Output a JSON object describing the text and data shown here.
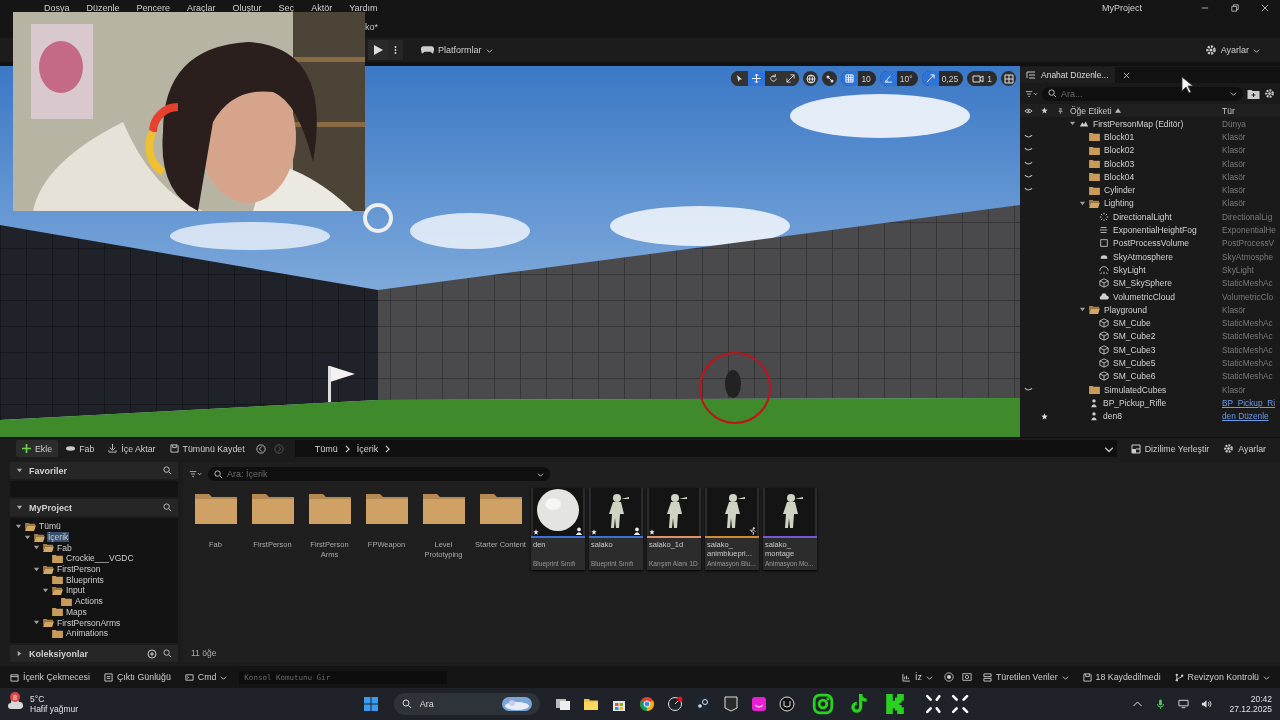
{
  "menu": [
    "Dosya",
    "Düzenle",
    "Pencere",
    "Araçlar",
    "Oluştur",
    "Seç",
    "Aktör",
    "Yardım"
  ],
  "document_tab": "ko*",
  "window_title": "MyProject",
  "toolbar": {
    "platforms": "Platformlar",
    "settings": "Ayarlar"
  },
  "viewport": {
    "kind": "picture",
    "tools": [
      {
        "kind": "select",
        "selected": false
      },
      {
        "kind": "move",
        "selected": true
      },
      {
        "kind": "rotate",
        "selected": false
      },
      {
        "kind": "scale",
        "selected": false
      }
    ],
    "snaps": [
      {
        "kind": "grid",
        "value": "10",
        "on": true
      },
      {
        "kind": "angle",
        "value": "10°",
        "on": true
      },
      {
        "kind": "scale",
        "value": "0,25",
        "on": true
      }
    ],
    "camera_speed": "1"
  },
  "outliner": {
    "tab": "Anahat Düzenle...",
    "search_placeholder": "Ara...",
    "columns": [
      "Öğe Etiketi",
      "Tür"
    ],
    "items": [
      {
        "label": "FirstPersonMap (Editör)",
        "type": "Dünya",
        "kind": "world",
        "hidden": false,
        "favorite": false,
        "link": false,
        "expanded": true,
        "children": [
          {
            "label": "Block01",
            "type": "Klasör",
            "kind": "folder",
            "hidden": true,
            "favorite": false,
            "link": false
          },
          {
            "label": "Block02",
            "type": "Klasör",
            "kind": "folder",
            "hidden": true,
            "favorite": false,
            "link": false
          },
          {
            "label": "Block03",
            "type": "Klasör",
            "kind": "folder",
            "hidden": true,
            "favorite": false,
            "link": false
          },
          {
            "label": "Block04",
            "type": "Klasör",
            "kind": "folder",
            "hidden": true,
            "favorite": false,
            "link": false
          },
          {
            "label": "Cylinder",
            "type": "Klasör",
            "kind": "folder",
            "hidden": true,
            "favorite": false,
            "link": false
          },
          {
            "label": "Lighting",
            "type": "Klasör",
            "kind": "folder",
            "hidden": false,
            "favorite": false,
            "link": false,
            "expanded": true,
            "children": [
              {
                "label": "DirectionalLight",
                "type": "DirectionalLig",
                "kind": "light",
                "hidden": false,
                "favorite": false,
                "link": false
              },
              {
                "label": "ExponentialHeightFog",
                "type": "ExponentialHe",
                "kind": "fog",
                "hidden": false,
                "favorite": false,
                "link": false
              },
              {
                "label": "PostProcessVolume",
                "type": "PostProcessV",
                "kind": "volume",
                "hidden": false,
                "favorite": false,
                "link": false
              },
              {
                "label": "SkyAtmosphere",
                "type": "SkyAtmosphe",
                "kind": "atmosphere",
                "hidden": false,
                "favorite": false,
                "link": false
              },
              {
                "label": "SkyLight",
                "type": "SkyLight",
                "kind": "skylight",
                "hidden": false,
                "favorite": false,
                "link": false
              },
              {
                "label": "SM_SkySphere",
                "type": "StaticMeshAc",
                "kind": "mesh",
                "hidden": false,
                "favorite": false,
                "link": false
              },
              {
                "label": "VolumetricCloud",
                "type": "VolumetricClo",
                "kind": "cloud",
                "hidden": false,
                "favorite": false,
                "link": false
              }
            ]
          },
          {
            "label": "Playground",
            "type": "Klasör",
            "kind": "folder",
            "hidden": false,
            "favorite": false,
            "link": false,
            "expanded": true,
            "children": [
              {
                "label": "SM_Cube",
                "type": "StaticMeshAc",
                "kind": "mesh",
                "hidden": false,
                "favorite": false,
                "link": false
              },
              {
                "label": "SM_Cube2",
                "type": "StaticMeshAc",
                "kind": "mesh",
                "hidden": false,
                "favorite": false,
                "link": false
              },
              {
                "label": "SM_Cube3",
                "type": "StaticMeshAc",
                "kind": "mesh",
                "hidden": false,
                "favorite": false,
                "link": false
              },
              {
                "label": "SM_Cube5",
                "type": "StaticMeshAc",
                "kind": "mesh",
                "hidden": false,
                "favorite": false,
                "link": false
              },
              {
                "label": "SM_Cube6",
                "type": "StaticMeshAc",
                "kind": "mesh",
                "hidden": false,
                "favorite": false,
                "link": false
              }
            ]
          },
          {
            "label": "SimulatedCubes",
            "type": "Klasör",
            "kind": "folder",
            "hidden": true,
            "favorite": false,
            "link": false
          },
          {
            "label": "BP_Pickup_Rifle",
            "type": "BP_Pickup_Ri",
            "kind": "pawn",
            "hidden": false,
            "favorite": false,
            "link": true
          },
          {
            "label": "den8",
            "type": "den Düzenle",
            "kind": "pawn",
            "hidden": false,
            "favorite": true,
            "link": true
          }
        ]
      }
    ]
  },
  "content_browser": {
    "buttons": [
      "Ekle",
      "Fab",
      "İçe Aktar",
      "Tümünü Kaydet"
    ],
    "breadcrumb": [
      "Tümü",
      "İçerik"
    ],
    "layout_button": "Dizilime Yerleştir",
    "settings": "Ayarlar",
    "favorites": "Favoriler",
    "project": "MyProject",
    "collections": "Koleksiyonlar",
    "tree": [
      {
        "label": "Tümü",
        "selected": false,
        "expanded": true,
        "children": [
          {
            "label": "İçerik",
            "selected": true,
            "expanded": true,
            "children": [
              {
                "label": "Fab",
                "selected": false,
                "expanded": true,
                "children": [
                  {
                    "label": "Crockie___VGDC",
                    "selected": false
                  }
                ]
              },
              {
                "label": "FirstPerson",
                "selected": false,
                "expanded": true,
                "children": [
                  {
                    "label": "Blueprints",
                    "selected": false
                  },
                  {
                    "label": "Input",
                    "selected": false,
                    "expanded": true,
                    "children": [
                      {
                        "label": "Actions",
                        "selected": false
                      }
                    ]
                  },
                  {
                    "label": "Maps",
                    "selected": false
                  }
                ]
              },
              {
                "label": "FirstPersonArms",
                "selected": false,
                "expanded": true,
                "children": [
                  {
                    "label": "Animations",
                    "selected": false
                  }
                ]
              }
            ]
          }
        ]
      }
    ],
    "search_placeholder": "Ara: İçerik",
    "items": [
      {
        "kind": "folder",
        "name": "Fab"
      },
      {
        "kind": "folder",
        "name": "FirstPerson"
      },
      {
        "kind": "folder",
        "name": "FirstPerson Arms"
      },
      {
        "kind": "folder",
        "name": "FPWeapon"
      },
      {
        "kind": "folder",
        "name": "Level Prototyping"
      },
      {
        "kind": "folder",
        "name": "Starter Content"
      },
      {
        "kind": "blueprint",
        "name": "den",
        "type": "Blueprint Sınıfı",
        "color": "#3d6fd8",
        "favorite": true
      },
      {
        "kind": "blueprint",
        "name": "salako",
        "type": "Blueprint Sınıfı",
        "color": "#3d6fd8",
        "favorite": true
      },
      {
        "kind": "blend_space",
        "name": "salako_1d",
        "type": "Karışım Alanı 1D",
        "color": "#e0906a",
        "favorite": true
      },
      {
        "kind": "anim_blueprint",
        "name": "salako_ animbluepri...",
        "type": "Animasyon Blu...",
        "color": "#d08a30",
        "favorite": false
      },
      {
        "kind": "montage",
        "name": "salako_ montage",
        "type": "Animasyon Mo...",
        "color": "#7a55d8",
        "favorite": false
      }
    ],
    "count": "11 öğe"
  },
  "status_bar": {
    "left": [
      "İçerik Çekmecesi",
      "Çıktı Günlüğü",
      "Cmd"
    ],
    "console_placeholder": "Konsol Komutunu Gir",
    "trace": "İz",
    "derived": "Türetilen Veriler",
    "unsaved": "18 Kaydedilmedi",
    "revision": "Revizyon Kontrolü"
  },
  "taskbar": {
    "weather_badge": "8",
    "temperature": "5°C",
    "weather": "Hafif yağmur",
    "search": "Ara",
    "time": "20:42",
    "date": "27.12.2025"
  }
}
